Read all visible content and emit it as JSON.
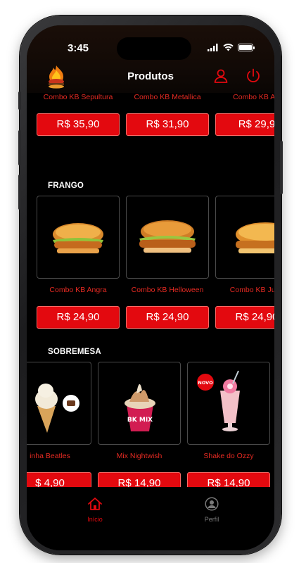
{
  "status_bar": {
    "time": "3:45"
  },
  "header": {
    "title": "Produtos",
    "logo_icon": "flame-burger-logo",
    "user_icon": "user-icon",
    "power_icon": "power-icon",
    "accent": "#e3090f"
  },
  "rows": [
    {
      "section": "",
      "items": [
        {
          "name": "Combo KB Sepultura",
          "price": "R$ 35,90"
        },
        {
          "name": "Combo KB Metallica",
          "price": "R$ 31,90"
        },
        {
          "name": "Combo KB AC",
          "price": "R$ 29,9"
        }
      ]
    },
    {
      "section": "FRANGO",
      "items": [
        {
          "name": "Combo KB Angra",
          "price": "R$ 24,90"
        },
        {
          "name": "Combo KB Helloween",
          "price": "R$ 24,90"
        },
        {
          "name": "Combo KB Juda",
          "price": "R$ 24,90"
        }
      ]
    },
    {
      "section": "SOBREMESA",
      "items": [
        {
          "name": "inha Beatles",
          "price": "$ 4,90"
        },
        {
          "name": "Mix Nightwish",
          "price": "R$ 14,90"
        },
        {
          "name": "Shake do Ozzy",
          "price": "R$ 14,90"
        }
      ]
    }
  ],
  "badges": {
    "novo": "NOVO",
    "cup_text": "BK MIX"
  },
  "nav": [
    {
      "label": "Início",
      "icon": "home-icon",
      "active": true
    },
    {
      "label": "Perfil",
      "icon": "profile-icon",
      "active": false
    }
  ]
}
